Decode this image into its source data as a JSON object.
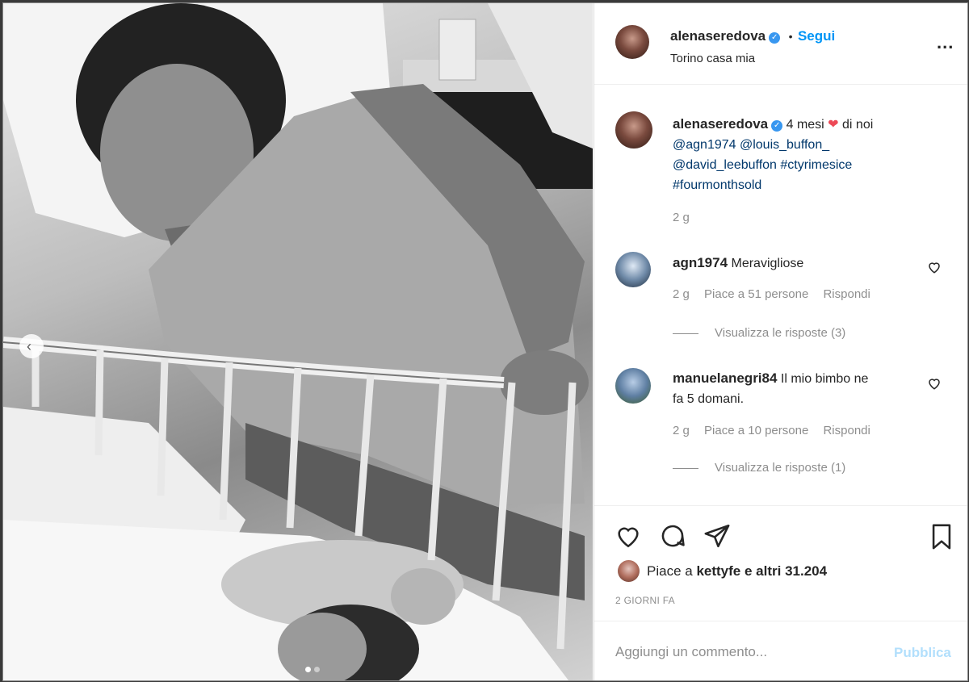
{
  "post": {
    "username": "alenaseredova",
    "follow_label": "Segui",
    "separator": "•",
    "location": "Torino casa mia",
    "more_label": "..."
  },
  "caption": {
    "username": "alenaseredova",
    "text_before": "4 mesi",
    "text_after": "di noi",
    "mentions": [
      "@agn1974",
      "@louis_buffon_",
      "@david_leebuffon"
    ],
    "hashtags": [
      "#ctyrimesice",
      "#fourmonthsold"
    ],
    "time": "2 g"
  },
  "comments": [
    {
      "username": "agn1974",
      "text": "Meravigliose",
      "time": "2 g",
      "likes": "Piace a 51 persone",
      "reply": "Rispondi",
      "view_replies": "Visualizza le risposte (3)"
    },
    {
      "username": "manuelanegri84",
      "text": "Il mio bimbo ne",
      "text2": "fa 5 domani.",
      "time": "2 g",
      "likes": "Piace a 10 persone",
      "reply": "Rispondi",
      "view_replies": "Visualizza le risposte (1)"
    }
  ],
  "likes": {
    "prefix": "Piace a",
    "user": "kettyfe",
    "suffix": "e altri 31.204"
  },
  "date": "2 GIORNI FA",
  "add_comment": {
    "placeholder": "Aggiungi un commento...",
    "publish_label": "Pubblica"
  },
  "colors": {
    "accent": "#0095f6",
    "verified": "#3897f0",
    "heart": "#ed4956",
    "link": "#00376b"
  },
  "icons": [
    "heart-icon",
    "comment-icon",
    "share-icon",
    "bookmark-icon",
    "chevron-left-icon",
    "verified-icon"
  ]
}
